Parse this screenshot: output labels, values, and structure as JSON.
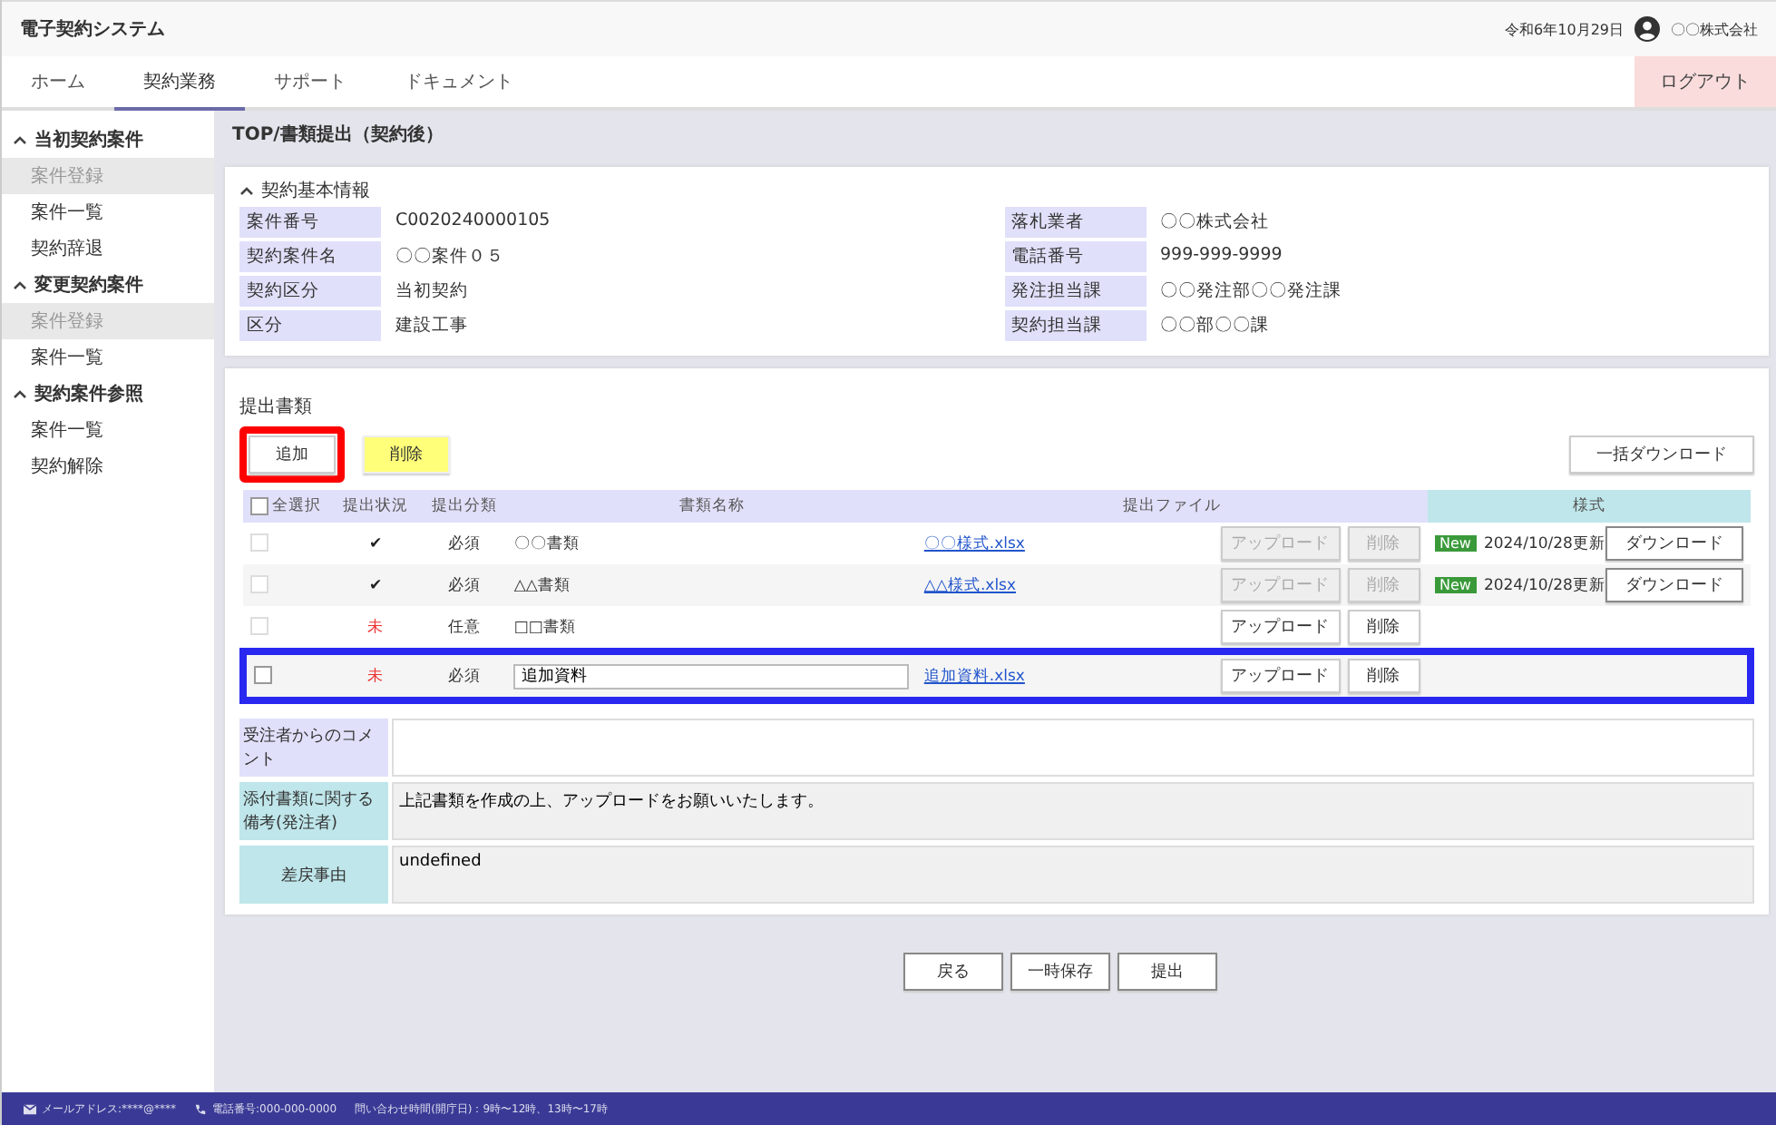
{
  "app_title": "電子契約システム",
  "header": {
    "date": "令和6年10月29日",
    "user": "〇〇株式会社",
    "logout": "ログアウト"
  },
  "tabs": [
    {
      "label": "ホーム",
      "selected": false
    },
    {
      "label": "契約業務",
      "selected": true
    },
    {
      "label": "サポート",
      "selected": false
    },
    {
      "label": "ドキュメント",
      "selected": false
    }
  ],
  "sidebar": [
    {
      "label": "当初契約案件",
      "expanded": true,
      "children": [
        {
          "label": "案件登録",
          "selected": true
        },
        {
          "label": "案件一覧",
          "selected": false
        },
        {
          "label": "契約辞退",
          "selected": false
        }
      ]
    },
    {
      "label": "変更契約案件",
      "expanded": true,
      "children": [
        {
          "label": "案件登録",
          "selected": true
        },
        {
          "label": "案件一覧",
          "selected": false
        }
      ]
    },
    {
      "label": "契約案件参照",
      "expanded": true,
      "children": [
        {
          "label": "案件一覧",
          "selected": false
        },
        {
          "label": "契約解除",
          "selected": false
        }
      ]
    }
  ],
  "breadcrumb": "TOP/書類提出（契約後）",
  "basic_info": {
    "title": "契約基本情報",
    "expanded": true,
    "left": [
      {
        "label": "案件番号",
        "value": "C0020240000105"
      },
      {
        "label": "契約案件名",
        "value": "〇〇案件０５"
      },
      {
        "label": "契約区分",
        "value": "当初契約"
      },
      {
        "label": "区分",
        "value": "建設工事"
      }
    ],
    "right": [
      {
        "label": "落札業者",
        "value": "〇〇株式会社"
      },
      {
        "label": "電話番号",
        "value": "999-999-9999"
      },
      {
        "label": "発注担当課",
        "value": "〇〇発注部〇〇発注課"
      },
      {
        "label": "契約担当課",
        "value": "〇〇部〇〇課"
      }
    ]
  },
  "documents": {
    "title": "提出書類",
    "buttons": [
      {
        "label": "追加",
        "framed": true,
        "marked": false
      },
      {
        "label": "削除",
        "framed": false,
        "marked": true
      }
    ],
    "bulk_download": "一括ダウンロード",
    "columns": [
      "全選択",
      "提出状況",
      "提出分類",
      "書類名称",
      "提出ファイル",
      "様式"
    ],
    "select_all": false,
    "rows": [
      {
        "checked": false,
        "disabled": true,
        "status": "✔",
        "submitted": true,
        "category": "必須",
        "name": "〇〇書類",
        "editable": false,
        "file": "〇〇様式.xlsx",
        "upload": "アップロード",
        "delete": "削除",
        "actions_disabled": true,
        "badge": "New",
        "updated": "2024/10/28更新",
        "download": "ダウンロード",
        "framed": false
      },
      {
        "checked": false,
        "disabled": true,
        "status": "✔",
        "submitted": true,
        "category": "必須",
        "name": "△△書類",
        "editable": false,
        "file": "△△様式.xlsx",
        "upload": "アップロード",
        "delete": "削除",
        "actions_disabled": true,
        "badge": "New",
        "updated": "2024/10/28更新",
        "download": "ダウンロード",
        "framed": false
      },
      {
        "checked": false,
        "disabled": true,
        "status": "未",
        "submitted": false,
        "category": "任意",
        "name": "□□書類",
        "editable": false,
        "upload": "アップロード",
        "delete": "削除",
        "actions_disabled": false,
        "framed": false
      },
      {
        "checked": false,
        "disabled": false,
        "status": "未",
        "submitted": false,
        "category": "必須",
        "name": "追加資料",
        "editable": true,
        "file": "追加資料.xlsx",
        "upload": "アップロード",
        "delete": "削除",
        "actions_disabled": false,
        "framed": true
      }
    ]
  },
  "remarks": [
    {
      "label": "受注者からのコメント",
      "kind": "input"
    },
    {
      "label": "添付書類に関する備考(発注者)",
      "value": "上記書類を作成の上、アップロードをお願いいたします。",
      "kind": "readonly"
    },
    {
      "label": "差戻事由",
      "value": "undefined",
      "kind": "readonly"
    }
  ],
  "actions": [
    "戻る",
    "一時保存",
    "提出"
  ],
  "footer": {
    "email": "メールアドレス:****@****",
    "phone": "電話番号:000-000-0000",
    "hours": "問い合わせ時間(開庁日)：9時〜12時、13時〜17時"
  }
}
